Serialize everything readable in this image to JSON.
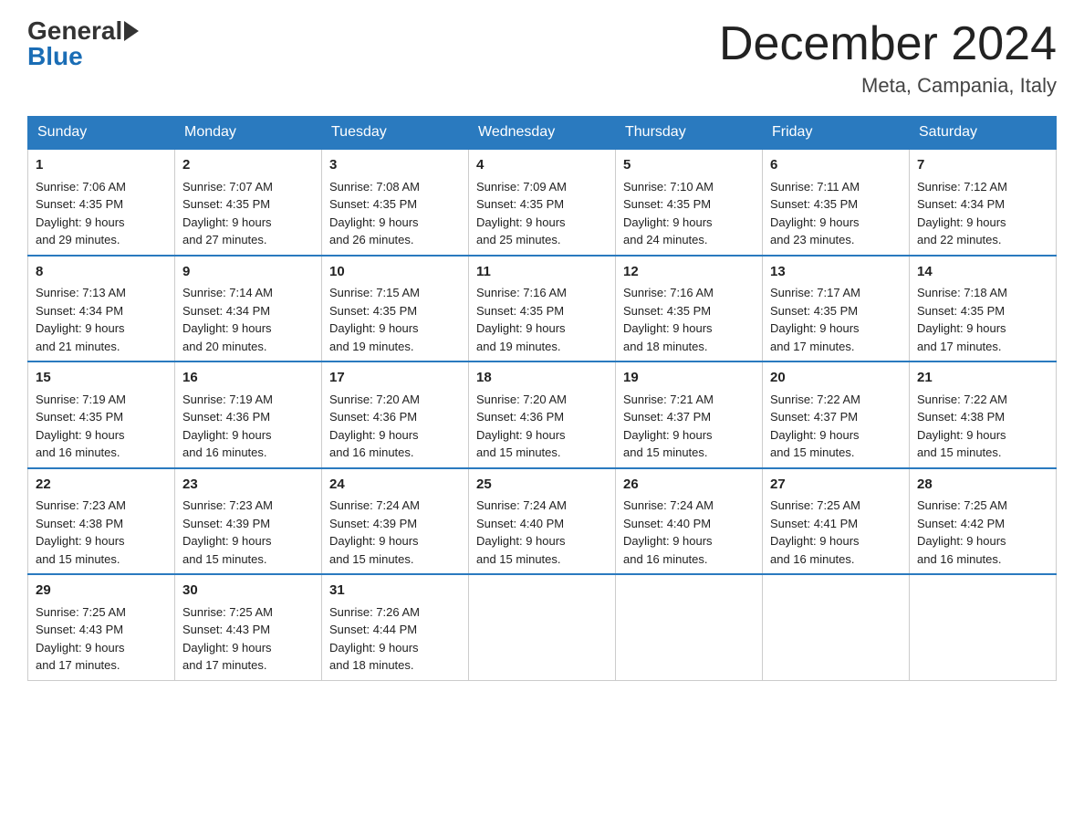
{
  "header": {
    "logo_general": "General",
    "logo_blue": "Blue",
    "month_title": "December 2024",
    "location": "Meta, Campania, Italy"
  },
  "days_of_week": [
    "Sunday",
    "Monday",
    "Tuesday",
    "Wednesday",
    "Thursday",
    "Friday",
    "Saturday"
  ],
  "weeks": [
    [
      {
        "day": "1",
        "sunrise": "7:06 AM",
        "sunset": "4:35 PM",
        "daylight": "9 hours and 29 minutes."
      },
      {
        "day": "2",
        "sunrise": "7:07 AM",
        "sunset": "4:35 PM",
        "daylight": "9 hours and 27 minutes."
      },
      {
        "day": "3",
        "sunrise": "7:08 AM",
        "sunset": "4:35 PM",
        "daylight": "9 hours and 26 minutes."
      },
      {
        "day": "4",
        "sunrise": "7:09 AM",
        "sunset": "4:35 PM",
        "daylight": "9 hours and 25 minutes."
      },
      {
        "day": "5",
        "sunrise": "7:10 AM",
        "sunset": "4:35 PM",
        "daylight": "9 hours and 24 minutes."
      },
      {
        "day": "6",
        "sunrise": "7:11 AM",
        "sunset": "4:35 PM",
        "daylight": "9 hours and 23 minutes."
      },
      {
        "day": "7",
        "sunrise": "7:12 AM",
        "sunset": "4:34 PM",
        "daylight": "9 hours and 22 minutes."
      }
    ],
    [
      {
        "day": "8",
        "sunrise": "7:13 AM",
        "sunset": "4:34 PM",
        "daylight": "9 hours and 21 minutes."
      },
      {
        "day": "9",
        "sunrise": "7:14 AM",
        "sunset": "4:34 PM",
        "daylight": "9 hours and 20 minutes."
      },
      {
        "day": "10",
        "sunrise": "7:15 AM",
        "sunset": "4:35 PM",
        "daylight": "9 hours and 19 minutes."
      },
      {
        "day": "11",
        "sunrise": "7:16 AM",
        "sunset": "4:35 PM",
        "daylight": "9 hours and 19 minutes."
      },
      {
        "day": "12",
        "sunrise": "7:16 AM",
        "sunset": "4:35 PM",
        "daylight": "9 hours and 18 minutes."
      },
      {
        "day": "13",
        "sunrise": "7:17 AM",
        "sunset": "4:35 PM",
        "daylight": "9 hours and 17 minutes."
      },
      {
        "day": "14",
        "sunrise": "7:18 AM",
        "sunset": "4:35 PM",
        "daylight": "9 hours and 17 minutes."
      }
    ],
    [
      {
        "day": "15",
        "sunrise": "7:19 AM",
        "sunset": "4:35 PM",
        "daylight": "9 hours and 16 minutes."
      },
      {
        "day": "16",
        "sunrise": "7:19 AM",
        "sunset": "4:36 PM",
        "daylight": "9 hours and 16 minutes."
      },
      {
        "day": "17",
        "sunrise": "7:20 AM",
        "sunset": "4:36 PM",
        "daylight": "9 hours and 16 minutes."
      },
      {
        "day": "18",
        "sunrise": "7:20 AM",
        "sunset": "4:36 PM",
        "daylight": "9 hours and 15 minutes."
      },
      {
        "day": "19",
        "sunrise": "7:21 AM",
        "sunset": "4:37 PM",
        "daylight": "9 hours and 15 minutes."
      },
      {
        "day": "20",
        "sunrise": "7:22 AM",
        "sunset": "4:37 PM",
        "daylight": "9 hours and 15 minutes."
      },
      {
        "day": "21",
        "sunrise": "7:22 AM",
        "sunset": "4:38 PM",
        "daylight": "9 hours and 15 minutes."
      }
    ],
    [
      {
        "day": "22",
        "sunrise": "7:23 AM",
        "sunset": "4:38 PM",
        "daylight": "9 hours and 15 minutes."
      },
      {
        "day": "23",
        "sunrise": "7:23 AM",
        "sunset": "4:39 PM",
        "daylight": "9 hours and 15 minutes."
      },
      {
        "day": "24",
        "sunrise": "7:24 AM",
        "sunset": "4:39 PM",
        "daylight": "9 hours and 15 minutes."
      },
      {
        "day": "25",
        "sunrise": "7:24 AM",
        "sunset": "4:40 PM",
        "daylight": "9 hours and 15 minutes."
      },
      {
        "day": "26",
        "sunrise": "7:24 AM",
        "sunset": "4:40 PM",
        "daylight": "9 hours and 16 minutes."
      },
      {
        "day": "27",
        "sunrise": "7:25 AM",
        "sunset": "4:41 PM",
        "daylight": "9 hours and 16 minutes."
      },
      {
        "day": "28",
        "sunrise": "7:25 AM",
        "sunset": "4:42 PM",
        "daylight": "9 hours and 16 minutes."
      }
    ],
    [
      {
        "day": "29",
        "sunrise": "7:25 AM",
        "sunset": "4:43 PM",
        "daylight": "9 hours and 17 minutes."
      },
      {
        "day": "30",
        "sunrise": "7:25 AM",
        "sunset": "4:43 PM",
        "daylight": "9 hours and 17 minutes."
      },
      {
        "day": "31",
        "sunrise": "7:26 AM",
        "sunset": "4:44 PM",
        "daylight": "9 hours and 18 minutes."
      },
      null,
      null,
      null,
      null
    ]
  ],
  "labels": {
    "sunrise": "Sunrise: ",
    "sunset": "Sunset: ",
    "daylight": "Daylight: "
  }
}
